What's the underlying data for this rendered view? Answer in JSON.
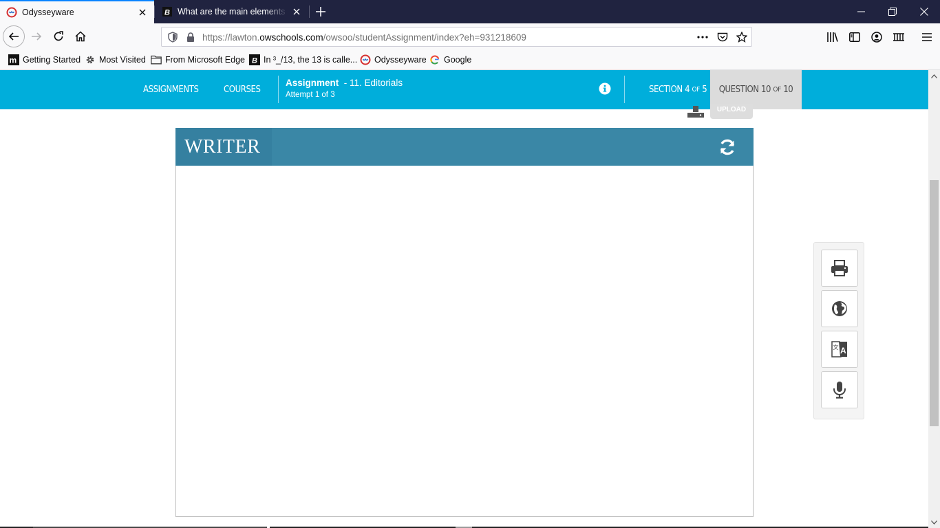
{
  "browser": {
    "tabs": [
      {
        "title": "Odysseyware",
        "active": true,
        "favicon": "odysseyware-icon"
      },
      {
        "title": "What are the main elements of",
        "active": false,
        "favicon": "brainly-icon"
      }
    ],
    "url": {
      "prefix": "https://lawton.",
      "host": "owschools.com",
      "path": "/owsoo/studentAssignment/index?eh=931218609"
    },
    "bookmarks": [
      {
        "label": "Getting Started",
        "icon": "mendeley-icon"
      },
      {
        "label": "Most Visited",
        "icon": "gear-icon"
      },
      {
        "label": "From Microsoft Edge",
        "icon": "folder-icon"
      },
      {
        "label": "In ³_/13, the 13 is calle...",
        "icon": "brainly-icon"
      },
      {
        "label": "Odysseyware",
        "icon": "odysseyware-icon"
      },
      {
        "label": "Google",
        "icon": "google-icon"
      }
    ],
    "colors": {
      "tabstrip": "#202340",
      "accent": "#0a84ff"
    }
  },
  "app": {
    "nav": {
      "assignments": "ASSIGNMENTS",
      "courses": "COURSES"
    },
    "assignment": {
      "label": "Assignment",
      "name": "- 11. Editorials",
      "attempt": "Attempt 1 of 3"
    },
    "section": {
      "word": "SECTION",
      "num": "4",
      "of": "OF",
      "total": "5"
    },
    "question": {
      "word": "QUESTION",
      "num": "10",
      "of": "OF",
      "total": "10"
    },
    "upload_label": "UPLOAD",
    "writer_title": "WRITER",
    "tools": [
      "print-icon",
      "globe-icon",
      "translate-icon",
      "microphone-icon"
    ],
    "colors": {
      "appbar": "#00aedb",
      "writer_header": "#3a87a6"
    }
  }
}
